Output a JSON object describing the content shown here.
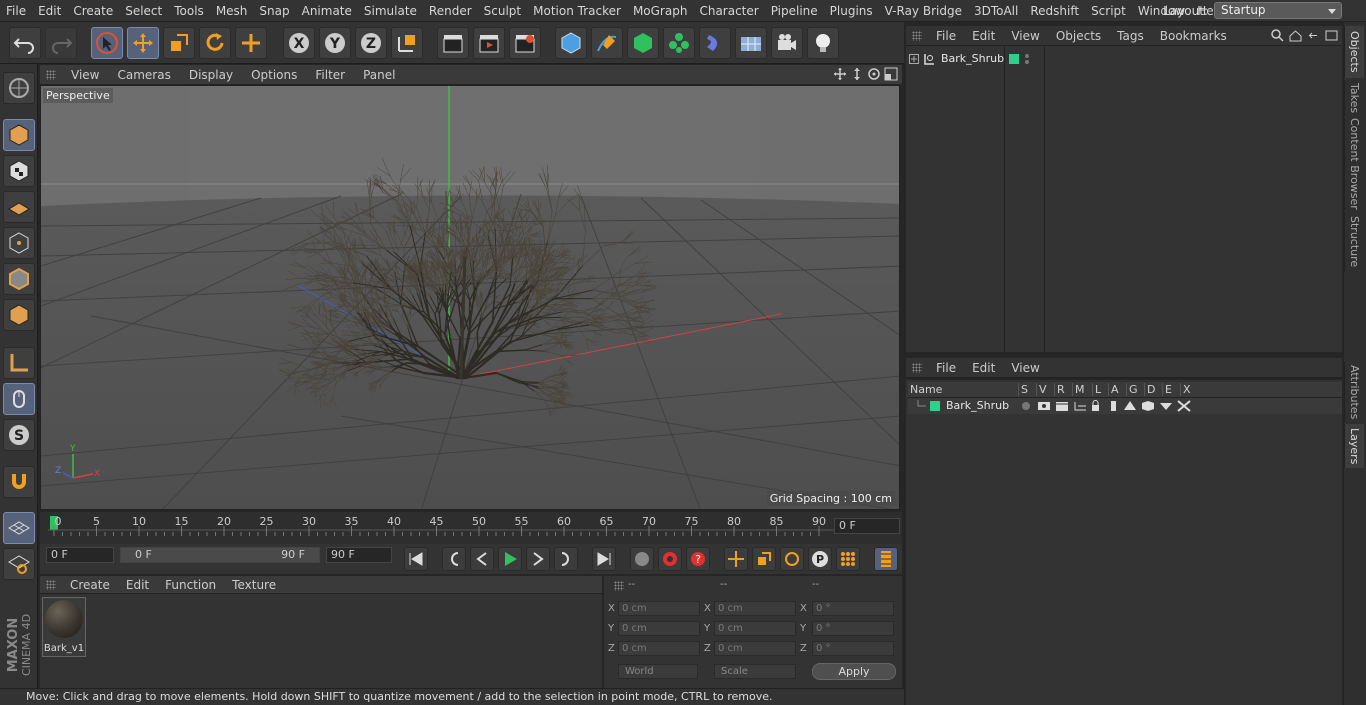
{
  "menubar": [
    "File",
    "Edit",
    "Create",
    "Select",
    "Tools",
    "Mesh",
    "Snap",
    "Animate",
    "Simulate",
    "Render",
    "Sculpt",
    "Motion Tracker",
    "MoGraph",
    "Character",
    "Pipeline",
    "Plugins",
    "V-Ray Bridge",
    "3DToAll",
    "Redshift",
    "Script",
    "Window",
    "Help"
  ],
  "layout": {
    "label": "Layout:",
    "value": "Startup"
  },
  "viewport": {
    "menu": [
      "View",
      "Cameras",
      "Display",
      "Options",
      "Filter",
      "Panel"
    ],
    "camera_label": "Perspective",
    "grid_spacing": "Grid Spacing : 100 cm",
    "axis_labels": {
      "x": "X",
      "y": "Y",
      "z": "Z"
    }
  },
  "timeline": {
    "ticks": [
      "0",
      "5",
      "10",
      "15",
      "20",
      "25",
      "30",
      "35",
      "40",
      "45",
      "50",
      "55",
      "60",
      "65",
      "70",
      "75",
      "80",
      "85",
      "90"
    ],
    "current_frame": "0 F"
  },
  "transport": {
    "start_frame": "0 F",
    "range_start": "0 F",
    "range_end": "90 F",
    "end_frame": "90 F"
  },
  "material_manager": {
    "menu": [
      "Create",
      "Edit",
      "Function",
      "Texture"
    ],
    "materials": [
      {
        "name": "Bark_v1"
      }
    ]
  },
  "coordinates": {
    "headers": [
      "--",
      "--",
      "--"
    ],
    "rows": [
      {
        "axis": "X",
        "pos": "0 cm",
        "size_axis": "X",
        "size": "0 cm",
        "rot_axis": "X",
        "rot": "0 °"
      },
      {
        "axis": "Y",
        "pos": "0 cm",
        "size_axis": "Y",
        "size": "0 cm",
        "rot_axis": "Y",
        "rot": "0 °"
      },
      {
        "axis": "Z",
        "pos": "0 cm",
        "size_axis": "Z",
        "size": "0 cm",
        "rot_axis": "Z",
        "rot": "0 °"
      }
    ],
    "mode": "World",
    "transform": "Scale",
    "apply_label": "Apply"
  },
  "object_manager": {
    "menu": [
      "File",
      "Edit",
      "View",
      "Objects",
      "Tags",
      "Bookmarks"
    ],
    "objects": [
      {
        "name": "Bark_Shrub",
        "color": "#2fd08a"
      }
    ]
  },
  "layer_manager": {
    "menu": [
      "File",
      "Edit",
      "View"
    ],
    "columns": [
      "Name",
      "S",
      "V",
      "R",
      "M",
      "L",
      "A",
      "G",
      "D",
      "E",
      "X"
    ],
    "layers": [
      {
        "name": "Bark_Shrub",
        "color": "#2fd08a"
      }
    ]
  },
  "side_tabs": [
    "Objects",
    "Takes",
    "Content Browser",
    "Structure",
    "Attributes",
    "Layers"
  ],
  "brand": {
    "line1": "MAXON",
    "line2": "CINEMA 4D"
  },
  "status": "Move: Click and drag to move elements. Hold down SHIFT to quantize movement / add to the selection in point mode, CTRL to remove.",
  "colors": {
    "accent": "#56627a",
    "green_axis": "#3fbf3f",
    "red_axis": "#d84040",
    "blue_axis": "#4060d0"
  }
}
